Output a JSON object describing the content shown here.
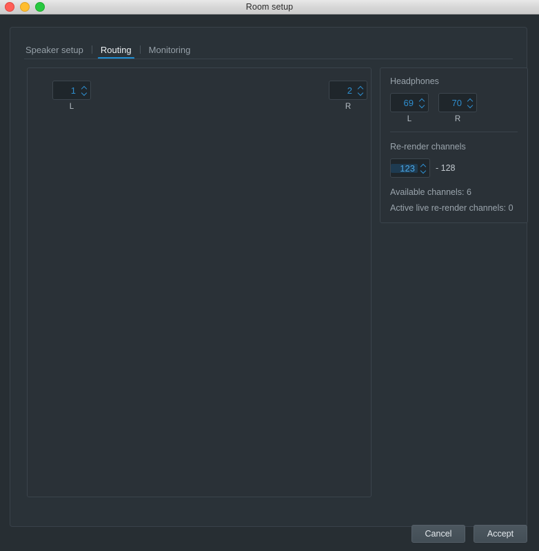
{
  "window": {
    "title": "Room setup",
    "controls": [
      {
        "name": "close",
        "label": ""
      },
      {
        "name": "minimize",
        "label": ""
      },
      {
        "name": "maximize",
        "label": ""
      }
    ]
  },
  "tabs": [
    {
      "label": "Speaker setup",
      "active": false
    },
    {
      "label": "Routing",
      "active": true
    },
    {
      "label": "Monitoring",
      "active": false
    }
  ],
  "routing": {
    "left_channel": {
      "value": "1",
      "label": "L"
    },
    "right_channel": {
      "value": "2",
      "label": "R"
    }
  },
  "headphones": {
    "title": "Headphones",
    "left": {
      "value": "69",
      "label": "L"
    },
    "right": {
      "value": "70",
      "label": "R"
    }
  },
  "rerender": {
    "title": "Re-render channels",
    "start": "123",
    "suffix": "- 128",
    "available": "Available channels: 6",
    "active_live": "Active live re-render channels: 0"
  },
  "footer": {
    "cancel": "Cancel",
    "accept": "Accept"
  },
  "colors": {
    "accent": "#1e8fd5",
    "spin_text": "#2f8fd0",
    "window_bg": "#272e33",
    "panel_bg": "#2a3238",
    "field_bg": "#1f262b"
  }
}
